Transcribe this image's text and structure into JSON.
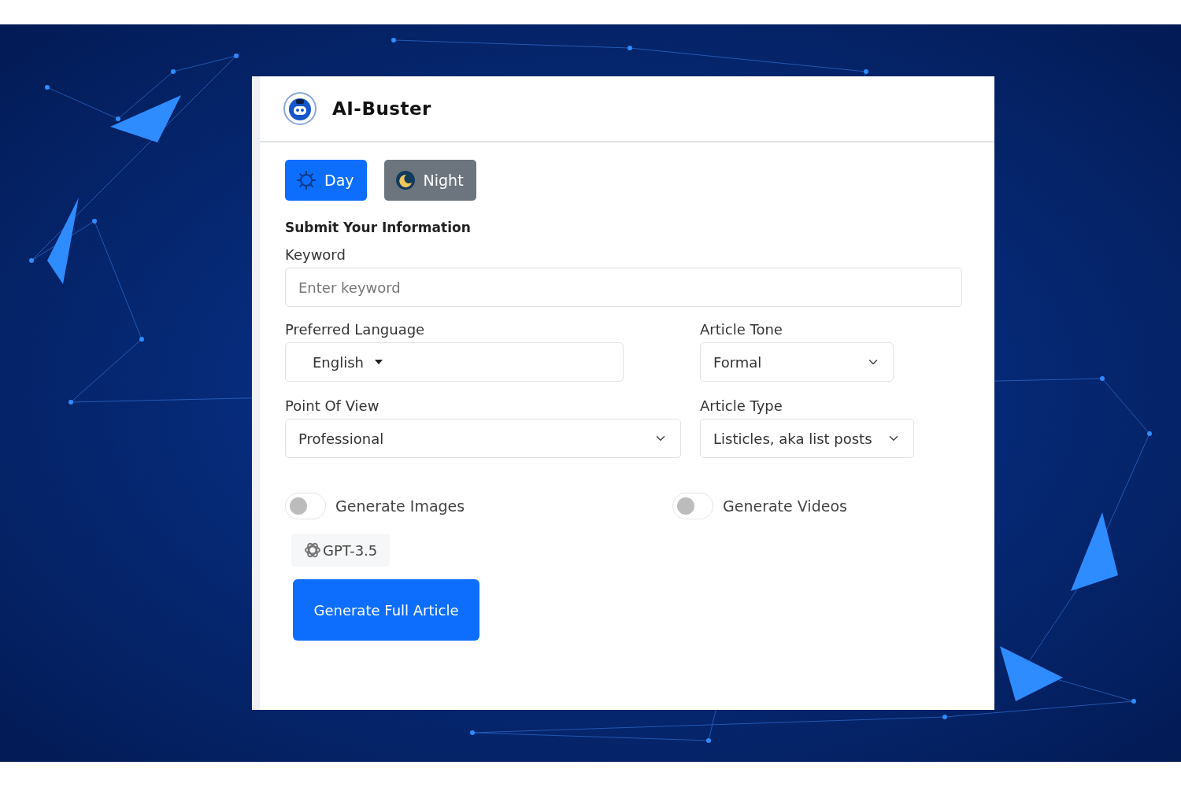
{
  "app": {
    "title": "AI-Buster"
  },
  "theme_buttons": [
    {
      "kind": "day",
      "label": "Day",
      "selected": true
    },
    {
      "kind": "night",
      "label": "Night",
      "selected": false
    }
  ],
  "form": {
    "heading": "Submit Your Information",
    "keyword": {
      "label": "Keyword",
      "placeholder": "Enter keyword"
    },
    "language": {
      "label": "Preferred Language",
      "value": "English"
    },
    "tone": {
      "label": "Article Tone",
      "value": "Formal"
    },
    "point_of_view": {
      "label": "Point Of View",
      "value": "Professional"
    },
    "article_type": {
      "label": "Article Type",
      "value": "Listicles, aka list posts"
    }
  },
  "toggles": [
    {
      "label": "Generate Images",
      "on": false
    },
    {
      "label": "Generate Videos",
      "on": false
    }
  ],
  "model_badge": {
    "label": "GPT-3.5"
  },
  "submit_button": {
    "label": "Generate Full Article"
  }
}
